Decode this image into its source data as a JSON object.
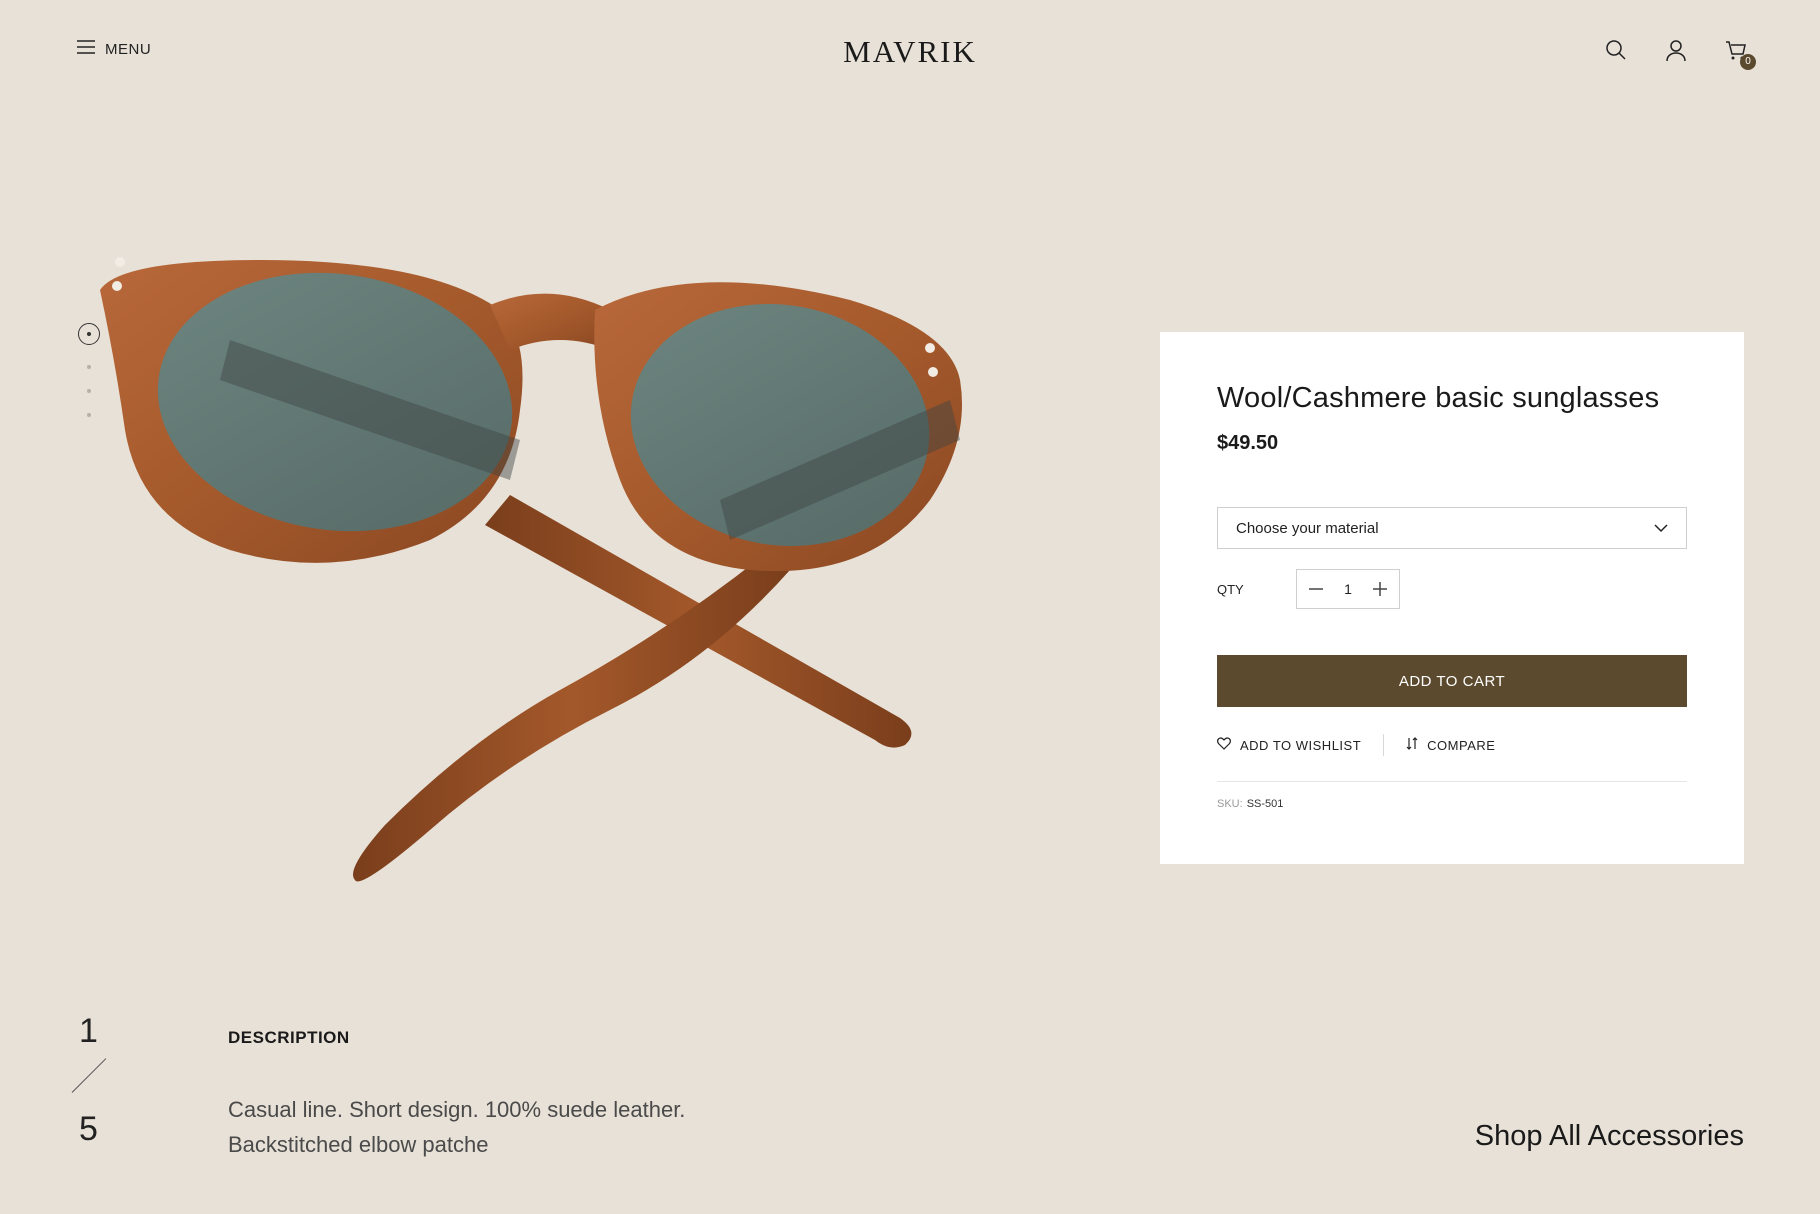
{
  "header": {
    "menu_label": "MENU",
    "logo": "MAVRIK",
    "cart_count": "0"
  },
  "product": {
    "title": "Wool/Cashmere basic sunglasses",
    "price": "$49.50",
    "material_select": "Choose your material",
    "qty_label": "QTY",
    "qty_value": "1",
    "add_to_cart": "ADD TO CART",
    "wishlist_label": "ADD TO WISHLIST",
    "compare_label": "COMPARE",
    "sku_label": "SKU:",
    "sku_value": "SS-501",
    "image_alt_icon": "sunglasses-product-image",
    "colors": {
      "button": "#5c4a2e",
      "background": "#e8e1d7",
      "card": "#ffffff"
    }
  },
  "slider": {
    "current": "1",
    "total": "5"
  },
  "description": {
    "title": "DESCRIPTION",
    "line1": "Casual line. Short design. 100% suede leather.",
    "line2": "Backstitched elbow patche"
  },
  "shop_all": "Shop All Accessories"
}
